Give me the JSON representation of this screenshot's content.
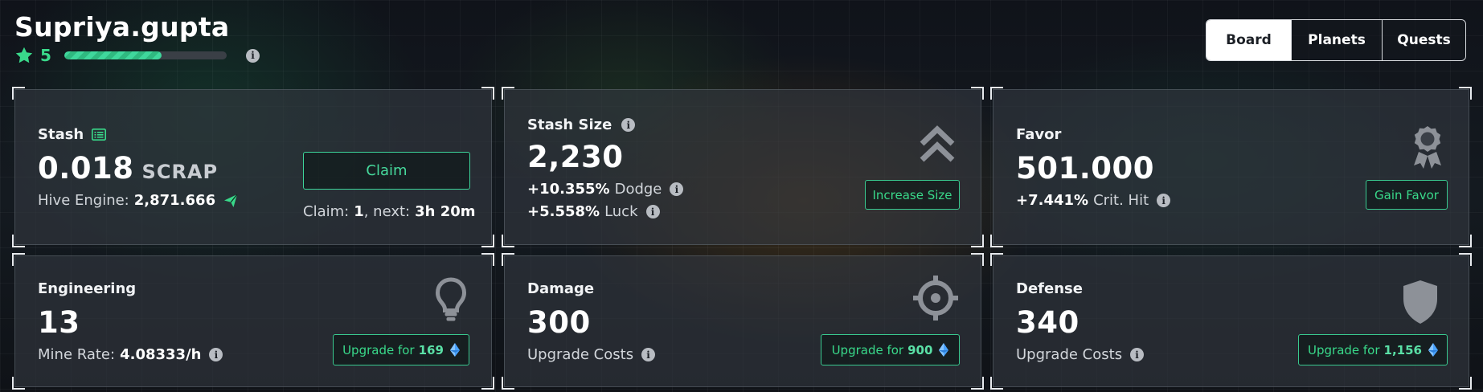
{
  "header": {
    "username": "Supriya.gupta",
    "level": "5",
    "level_progress": 0.6
  },
  "tabs": [
    {
      "label": "Board",
      "active": true
    },
    {
      "label": "Planets",
      "active": false
    },
    {
      "label": "Quests",
      "active": false
    }
  ],
  "stash": {
    "title": "Stash",
    "value": "0.018",
    "unit": "SCRAP",
    "hive_label": "Hive Engine:",
    "hive_value": "2,871.666",
    "claim_label": "Claim",
    "claim_prefix": "Claim:",
    "claim_count": "1",
    "claim_next_label": ", next:",
    "claim_next_value": "3h 20m"
  },
  "stash_size": {
    "title": "Stash Size",
    "value": "2,230",
    "dodge_value": "+10.355%",
    "dodge_label": "Dodge",
    "luck_value": "+5.558%",
    "luck_label": "Luck",
    "button_label": "Increase Size"
  },
  "favor": {
    "title": "Favor",
    "value": "501.000",
    "crit_value": "+7.441%",
    "crit_label": "Crit. Hit",
    "button_label": "Gain Favor"
  },
  "engineering": {
    "title": "Engineering",
    "value": "13",
    "rate_label": "Mine Rate:",
    "rate_value": "4.08333/h",
    "button_prefix": "Upgrade for",
    "button_cost": "169"
  },
  "damage": {
    "title": "Damage",
    "value": "300",
    "sub_label": "Upgrade Costs",
    "button_prefix": "Upgrade for",
    "button_cost": "900"
  },
  "defense": {
    "title": "Defense",
    "value": "340",
    "sub_label": "Upgrade Costs",
    "button_prefix": "Upgrade for",
    "button_cost": "1,156"
  },
  "icons": {
    "star": "star-icon",
    "info": "info-icon",
    "ledger": "ledger-icon",
    "send": "send-icon",
    "chevrons": "double-chevron-up-icon",
    "award": "award-ribbon-icon",
    "lightbulb": "lightbulb-icon",
    "crosshair": "crosshair-icon",
    "shield": "shield-icon",
    "gem": "blue-gem-icon"
  },
  "colors": {
    "accent_green": "#39d98a",
    "button_border": "#39c98f",
    "gem_blue": "#4aa3ff"
  }
}
